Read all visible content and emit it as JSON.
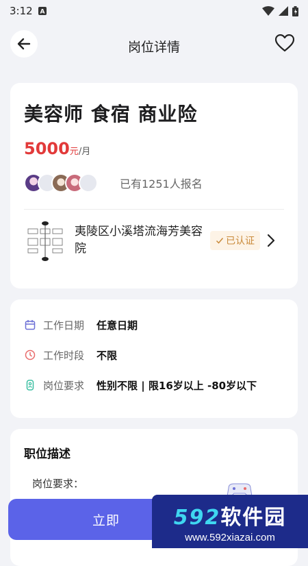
{
  "status": {
    "time": "3:12"
  },
  "header": {
    "title": "岗位详情"
  },
  "job": {
    "title": "美容师 食宿 商业险",
    "salary_amount": "5000",
    "salary_unit": "元",
    "salary_period": "/月",
    "applicant_text": "已有1251人报名"
  },
  "company": {
    "name": "夷陵区小溪塔流海芳美容院",
    "verified_label": "已认证"
  },
  "info": [
    {
      "label": "工作日期",
      "value": "任意日期",
      "icon": "calendar-icon",
      "color": "#6b6fd6"
    },
    {
      "label": "工作时段",
      "value": "不限",
      "icon": "clock-icon",
      "color": "#e86a6a"
    },
    {
      "label": "岗位要求",
      "value": "性别不限 | 限16岁以上 -80岁以下",
      "icon": "person-icon",
      "color": "#3bbfa2"
    }
  ],
  "description": {
    "title": "职位描述",
    "first_line": "岗位要求："
  },
  "apply": {
    "label": "立即"
  },
  "watermark": {
    "brand_num": "592",
    "brand_text": "软件园",
    "url": "www.592xiazai.com"
  },
  "colors": {
    "accent": "#5b63e8",
    "salary": "#e23a3a",
    "verified": "#c98a3a"
  }
}
